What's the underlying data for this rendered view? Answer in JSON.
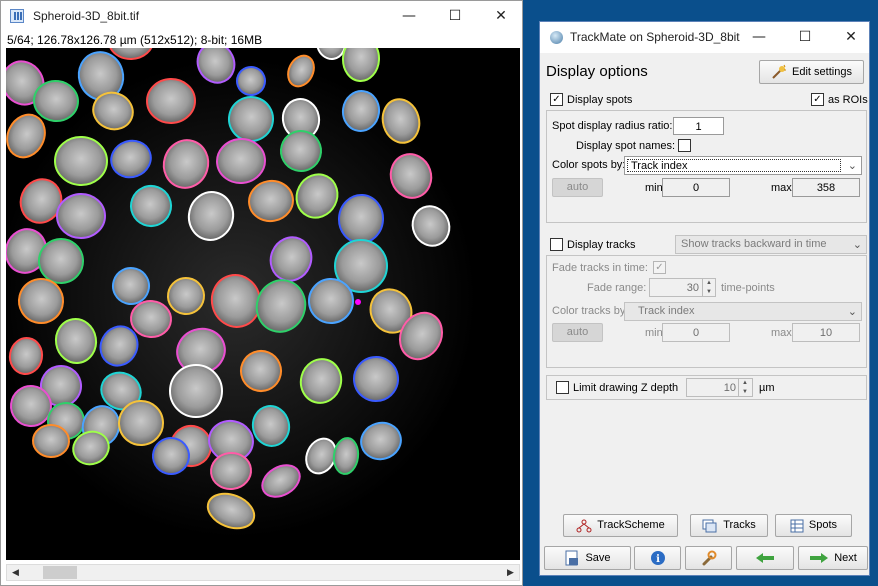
{
  "image_window": {
    "title": "Spheroid-3D_8bit.tif",
    "info": "5/64; 126.78x126.78 µm (512x512); 8-bit; 16MB",
    "controls": {
      "minimize": "—",
      "maximize": "☐",
      "close": "✕"
    },
    "scroll": {
      "left": "◀",
      "right": "▶"
    }
  },
  "trackmate": {
    "title": "TrackMate on Spheroid-3D_8bit",
    "controls": {
      "minimize": "—",
      "maximize": "☐",
      "close": "✕"
    },
    "heading": "Display options",
    "edit_settings": "Edit settings",
    "display_spots": {
      "label": "Display spots",
      "checked": true
    },
    "as_rois": {
      "label": "as ROIs",
      "checked": true
    },
    "radius_ratio": {
      "label": "Spot display radius ratio:",
      "value": "1"
    },
    "spot_names": {
      "label": "Display spot names:",
      "checked": false
    },
    "color_spots": {
      "label": "Color spots by:",
      "value": "Track index"
    },
    "spots_range": {
      "auto": "auto",
      "min_label": "min",
      "min": "0",
      "max_label": "max",
      "max": "358"
    },
    "display_tracks": {
      "label": "Display tracks",
      "checked": false
    },
    "track_mode": "Show tracks backward in time",
    "fade_tracks": {
      "label": "Fade tracks in time:",
      "checked": true
    },
    "fade_range": {
      "label": "Fade range:",
      "value": "30",
      "unit": "time-points"
    },
    "color_tracks": {
      "label": "Color tracks by:",
      "value": "Track index"
    },
    "tracks_range": {
      "auto": "auto",
      "min_label": "min",
      "min": "0",
      "max_label": "max",
      "max": "10"
    },
    "limit_z": {
      "label": "Limit drawing Z depth",
      "value": "10",
      "unit": "µm",
      "checked": false
    },
    "buttons": {
      "trackscheme": "TrackScheme",
      "tracks": "Tracks",
      "spots": "Spots",
      "save": "Save",
      "next": "Next"
    }
  }
}
